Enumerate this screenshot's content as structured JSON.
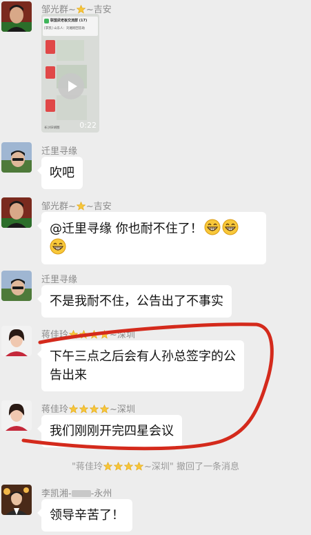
{
  "messages": [
    {
      "sender": "邹光群~",
      "sender_suffix": "~吉安",
      "type": "video",
      "video": {
        "app_title": "联盟武老板交流群 (17)",
        "preview_line": "[李凯] 山东人：刘湘刚回答助",
        "bottom_line": "长沙旧胡图",
        "duration": "0:22"
      }
    },
    {
      "sender": "迁里寻缘",
      "text": "吹吧"
    },
    {
      "sender": "邹光群~",
      "sender_suffix": "~吉安",
      "text": "@迁里寻缘  你也耐不住了！",
      "emoji_count": 3
    },
    {
      "sender": "迁里寻缘",
      "text": "不是我耐不住，公告出了不事实"
    },
    {
      "sender": "蒋佳玲",
      "sender_suffix": "~深圳",
      "star_count": 4,
      "text_line1": "下午三点之后会有人孙总签字的公",
      "text_line2": "告出来"
    },
    {
      "sender": "蒋佳玲",
      "sender_suffix": "~深圳",
      "star_count": 4,
      "text": "我们刚刚开完四星会议"
    },
    {
      "sender": "李凯湘-",
      "sender_suffix": "-永州",
      "text": "领导辛苦了！"
    }
  ],
  "system_message": {
    "prefix": "\"蒋佳玲",
    "suffix": "~深圳\" 撤回了一条消息",
    "star_count": 4
  },
  "annotation_color": "#d42a1c"
}
